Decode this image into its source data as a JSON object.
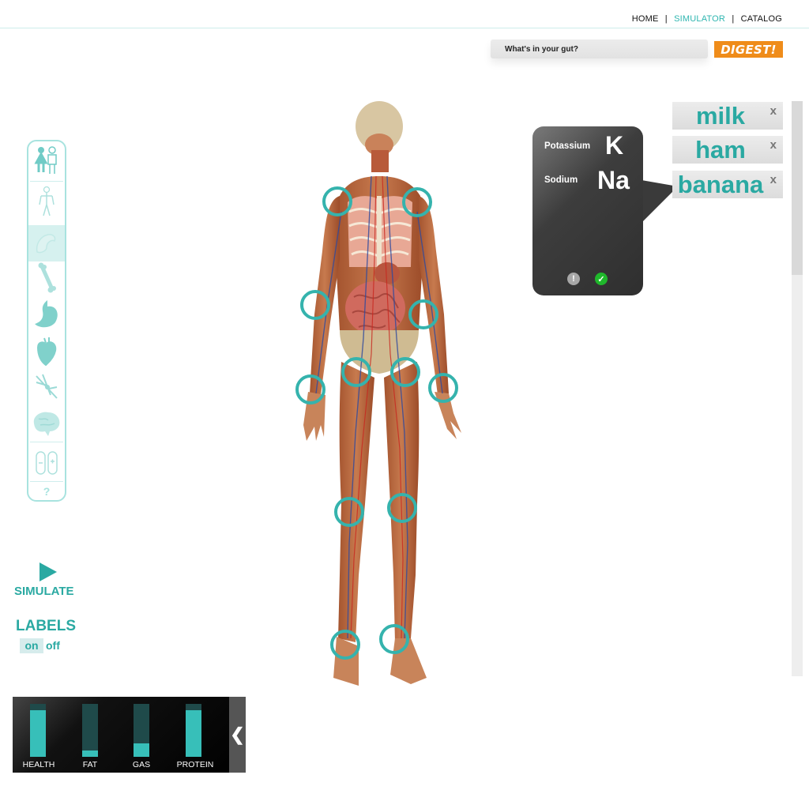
{
  "nav": {
    "home": "HOME",
    "sep1": "|",
    "simulator": "SIMULATOR",
    "sep2": "|",
    "catalog": "CATALOG"
  },
  "search": {
    "placeholder": "What's in your gut?",
    "value": "What's in your gut?",
    "button": "DIGEST!"
  },
  "tools": [
    "gender-icon",
    "body-outline-icon",
    "muscle-icon",
    "bone-icon",
    "stomach-icon",
    "heart-icon",
    "nerve-icon",
    "brain-icon",
    "pill-icon",
    "help-icon"
  ],
  "help_label": "?",
  "card": {
    "rows": [
      {
        "label": "Potassium",
        "symbol": "K"
      },
      {
        "label": "Sodium",
        "symbol": "Na"
      }
    ],
    "warn": "!",
    "ok": "✓"
  },
  "foods": [
    {
      "name": "milk",
      "remove": "x"
    },
    {
      "name": "ham",
      "remove": "x"
    },
    {
      "name": "banana",
      "remove": "x"
    }
  ],
  "simulate": "SIMULATE",
  "labels": {
    "title": "LABELS",
    "on": "on",
    "off": "off"
  },
  "stats": [
    {
      "label": "HEALTH",
      "level": 0.88
    },
    {
      "label": "FAT",
      "level": 0.12
    },
    {
      "label": "GAS",
      "level": 0.25
    },
    {
      "label": "PROTEIN",
      "level": 0.88
    }
  ],
  "collapse": "❮",
  "colors": {
    "accent": "#2aa9a2",
    "digest": "#ef8c1a",
    "ok": "#1fb82b"
  }
}
